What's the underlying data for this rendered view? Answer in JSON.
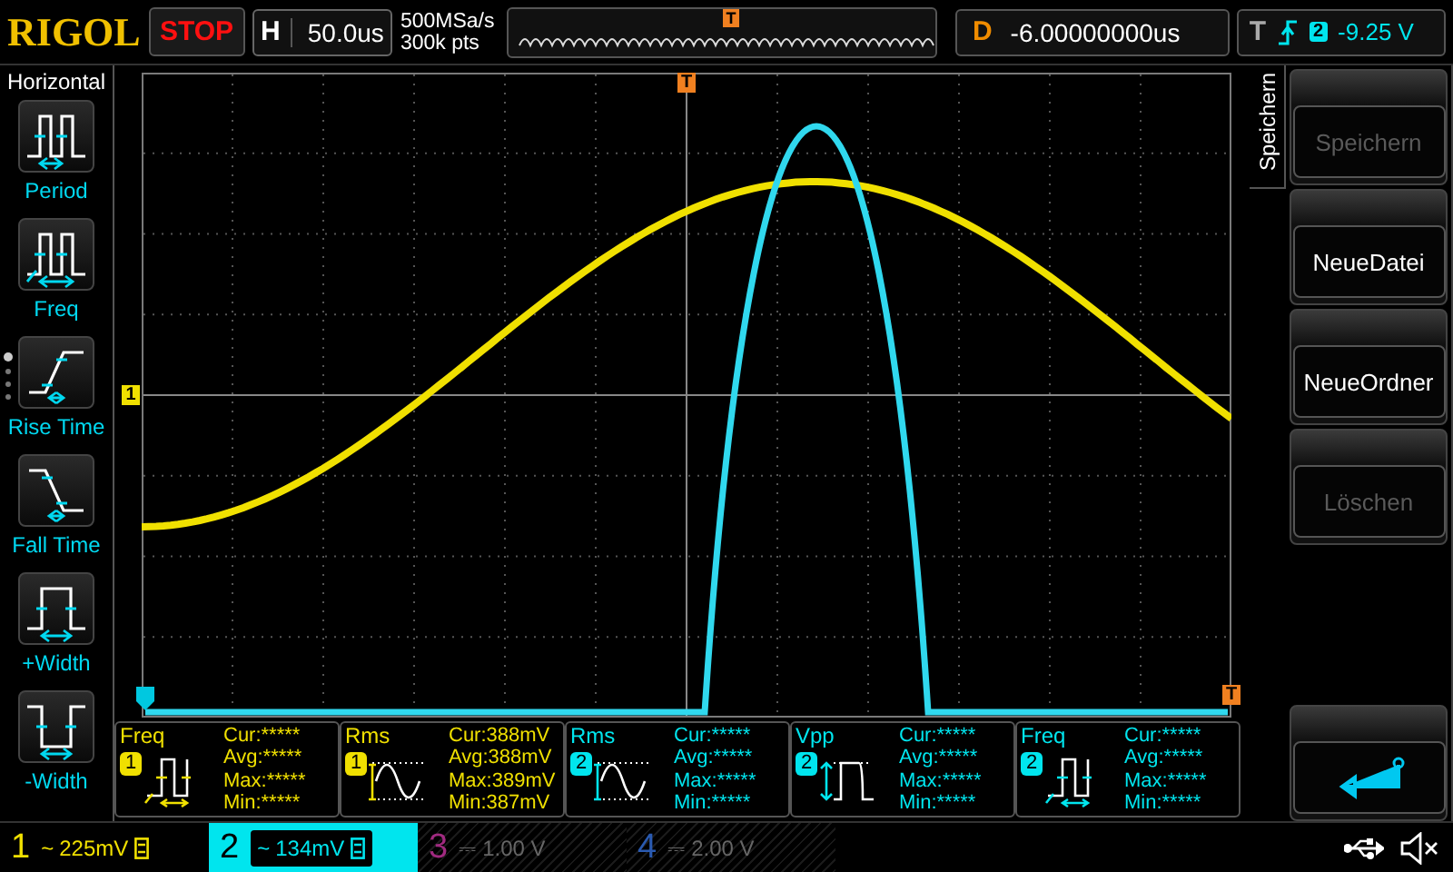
{
  "top_bar": {
    "logo": "RIGOL",
    "run_state": {
      "label": "STOP",
      "running": false
    },
    "timebase": {
      "label": "H",
      "value": "50.0us"
    },
    "sample_rate": "500MSa/s",
    "memory_depth": "300k pts",
    "overview_marker": "T",
    "delay": {
      "label": "D",
      "value": "-6.00000000us"
    },
    "trigger": {
      "label": "T",
      "source": "2",
      "level": "-9.25 V"
    }
  },
  "menu": {
    "title": "Horizontal",
    "items": [
      {
        "label": "Period",
        "kind": "period"
      },
      {
        "label": "Freq",
        "kind": "freq"
      },
      {
        "label": "Rise Time",
        "kind": "rise"
      },
      {
        "label": "Fall Time",
        "kind": "fall"
      },
      {
        "label": "+Width",
        "kind": "pwidth"
      },
      {
        "label": "-Width",
        "kind": "nwidth"
      }
    ],
    "page_dots": [
      {
        "selected": true
      },
      {
        "selected": false
      },
      {
        "selected": false
      },
      {
        "selected": false
      }
    ]
  },
  "plot": {
    "channel_marker": "1",
    "trigger_marker": "T",
    "trigger_level_marker": "T"
  },
  "measurements": [
    {
      "name": "Freq",
      "channel": "1",
      "color": "#f0e000",
      "kind": "freq",
      "stats": [
        "Cur:*****",
        "Avg:*****",
        "Max:*****",
        "Min:*****"
      ]
    },
    {
      "name": "Rms",
      "channel": "1",
      "color": "#f0e000",
      "kind": "rms",
      "stats": [
        "Cur:388mV",
        "Avg:388mV",
        "Max:389mV",
        "Min:387mV"
      ]
    },
    {
      "name": "Rms",
      "channel": "2",
      "color": "#00e5ee",
      "kind": "rms",
      "stats": [
        "Cur:*****",
        "Avg:*****",
        "Max:*****",
        "Min:*****"
      ]
    },
    {
      "name": "Vpp",
      "channel": "2",
      "color": "#00e5ee",
      "kind": "vpp",
      "stats": [
        "Cur:*****",
        "Avg:*****",
        "Max:*****",
        "Min:*****"
      ]
    },
    {
      "name": "Freq",
      "channel": "2",
      "color": "#00e5ee",
      "kind": "freq",
      "stats": [
        "Cur:*****",
        "Avg:*****",
        "Max:*****",
        "Min:*****"
      ]
    }
  ],
  "softkeys": {
    "tab": "Speichern",
    "buttons": [
      {
        "kind": "text",
        "label": "Speichern",
        "disabled": true
      },
      {
        "kind": "text",
        "label": "NeueDatei",
        "disabled": false
      },
      {
        "kind": "text",
        "label": "NeueOrdner",
        "disabled": false
      },
      {
        "kind": "text",
        "label": "Löschen",
        "disabled": true
      },
      {
        "kind": "spacer"
      },
      {
        "kind": "back"
      }
    ]
  },
  "channels": [
    {
      "number": "1",
      "coupling": "~",
      "scale": "225mV",
      "bw_limit": true,
      "enabled": true,
      "selected": false,
      "color": "#f0e000"
    },
    {
      "number": "2",
      "coupling": "~",
      "scale": "134mV",
      "bw_limit": true,
      "enabled": true,
      "selected": true,
      "color": "#00e5ee"
    },
    {
      "number": "3",
      "coupling": "⎓",
      "scale": "1.00 V",
      "bw_limit": false,
      "enabled": false,
      "selected": false,
      "color": "#a02a80"
    },
    {
      "number": "4",
      "coupling": "⎓",
      "scale": "2.00 V",
      "bw_limit": false,
      "enabled": false,
      "selected": false,
      "color": "#2a5ab0"
    }
  ]
}
